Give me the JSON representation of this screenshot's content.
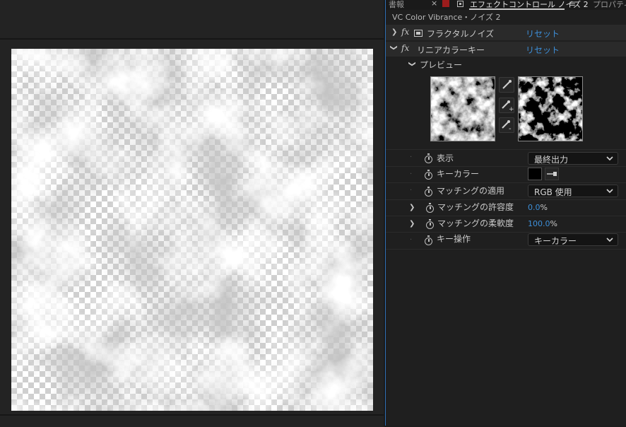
{
  "tabs": {
    "left": "書報",
    "close": "×",
    "effect_controls": "エフェクトコントロール ノイズ 2",
    "menu": "≡",
    "properties": "プロパティ"
  },
  "layer_title": "VC Color Vibrance・ノイズ 2",
  "effects": [
    {
      "name": "フラクタルノイズ",
      "reset": "リセット"
    },
    {
      "name": "リニアカラーキー",
      "reset": "リセット"
    }
  ],
  "preview_label": "プレビュー",
  "properties": {
    "display": {
      "label": "表示",
      "value": "最終出力"
    },
    "key_color": {
      "label": "キーカラー",
      "color": "#000000"
    },
    "matching_mode": {
      "label": "マッチングの適用",
      "value": "RGB 使用"
    },
    "matching_tolerance": {
      "label": "マッチングの許容度",
      "value": "0.0",
      "unit": "%"
    },
    "matching_softness": {
      "label": "マッチングの柔軟度",
      "value": "100.0",
      "unit": "%"
    },
    "key_operation": {
      "label": "キー操作",
      "value": "キーカラー"
    }
  },
  "colors": {
    "accent_blue": "#3d8fd9",
    "active_tab_underline": "#c7c7c7",
    "tab_red": "#9b1c1c"
  }
}
